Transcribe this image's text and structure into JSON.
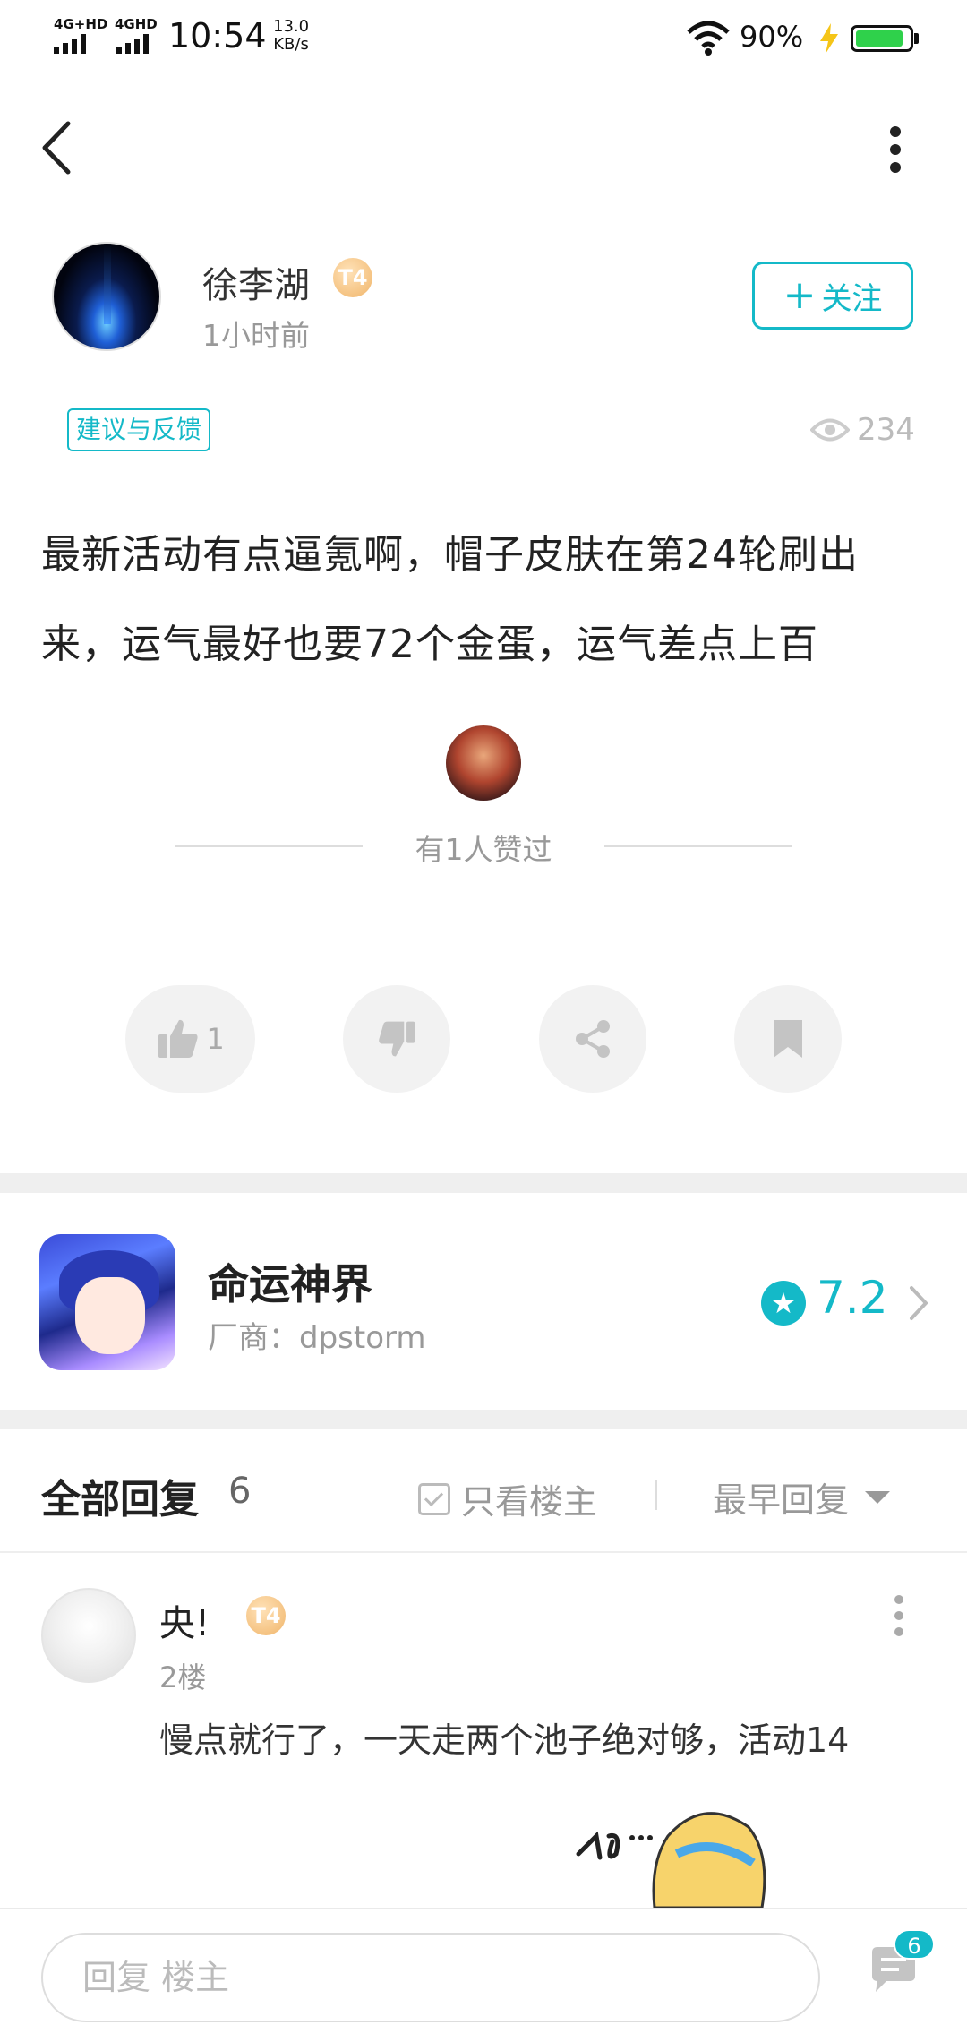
{
  "status_bar": {
    "network1": "4G+HD",
    "network2": "4GHD",
    "time": "10:54",
    "speed_value": "13.0",
    "speed_unit": "KB/s",
    "battery": "90%",
    "battery_level": 0.9
  },
  "post": {
    "author": "徐李湖",
    "level": "T4",
    "time": "1小时前",
    "follow_label": "关注",
    "tag": "建议与反馈",
    "views": "234",
    "content": "最新活动有点逼氪啊，帽子皮肤在第24轮刷出来，运气最好也要72个金蛋，运气差点上百",
    "liked_text": "有1人赞过",
    "like_count": "1"
  },
  "game": {
    "name": "命运神界",
    "vendor": "厂商：dpstorm",
    "rating": "7.2"
  },
  "replies": {
    "title": "全部回复",
    "count": "6",
    "only_op": "只看楼主",
    "sort": "最早回复",
    "items": [
      {
        "name": "央!",
        "level": "T4",
        "floor": "2楼",
        "text": "慢点就行了，一天走两个池子绝对够，活动14"
      }
    ]
  },
  "bottom_bar": {
    "placeholder": "回复 楼主",
    "comment_count": "6"
  },
  "colors": {
    "accent": "#14b9c8",
    "text": "#222222",
    "muted": "#999999",
    "battery": "#2fd14b"
  }
}
